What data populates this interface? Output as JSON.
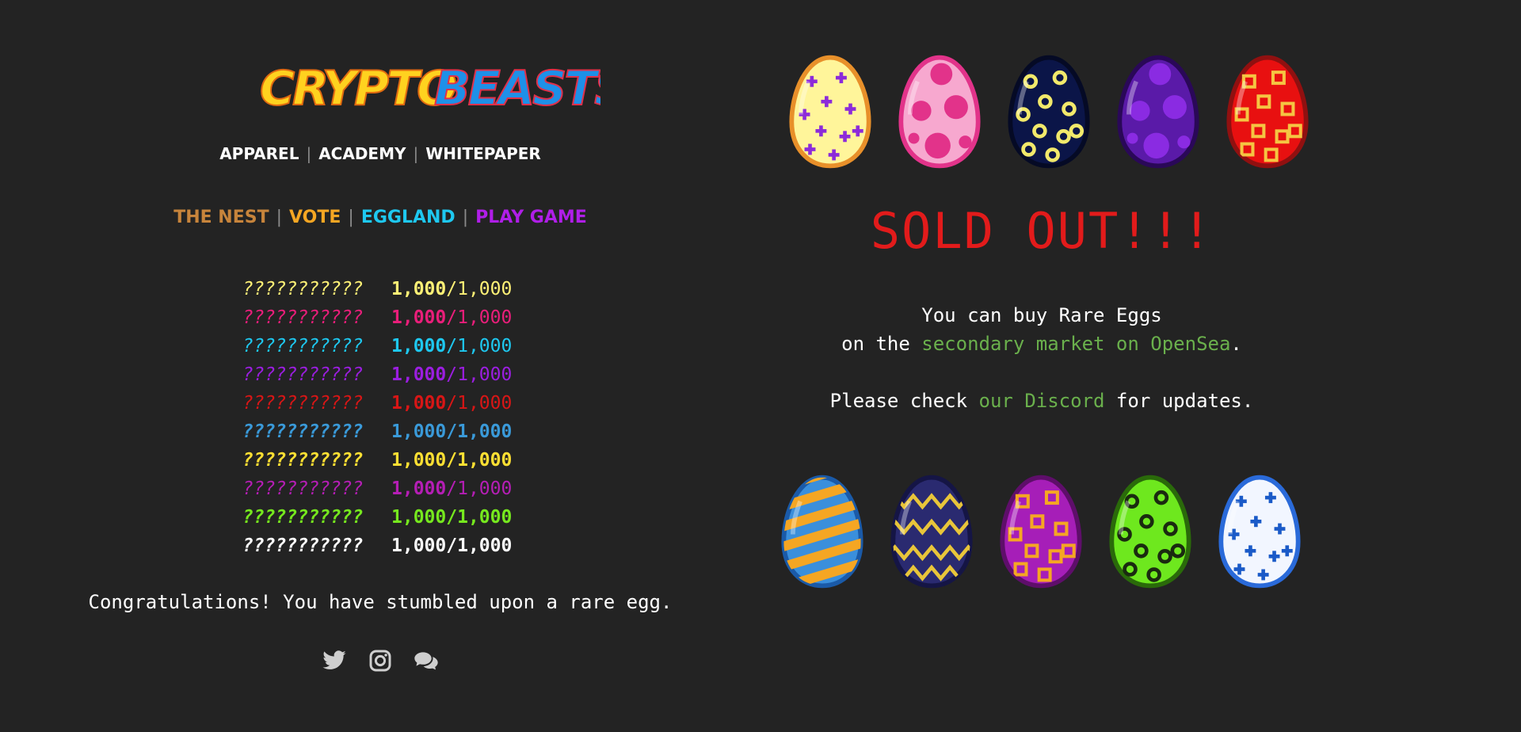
{
  "logo": {
    "text_part1": "CRYPTO",
    "text_part2": "BEASTS",
    "color1": "#ffd21f",
    "color2": "#1e90e8"
  },
  "nav_primary": [
    {
      "label": "APPAREL"
    },
    {
      "label": "ACADEMY"
    },
    {
      "label": "WHITEPAPER"
    }
  ],
  "nav_secondary": [
    {
      "label": "THE NEST",
      "color": "#c7843b"
    },
    {
      "label": "VOTE",
      "color": "#f5a623"
    },
    {
      "label": "EGGLAND",
      "color": "#1ec8f0"
    },
    {
      "label": "PLAY GAME",
      "color": "#b01ee8"
    }
  ],
  "separator": "|",
  "egg_counts": [
    {
      "name": "???????????",
      "minted": "1,000",
      "total": "/1,000",
      "color": "#fff176",
      "bold": false
    },
    {
      "name": "???????????",
      "minted": "1,000",
      "total": "/1,000",
      "color": "#e91e7a",
      "bold": false
    },
    {
      "name": "???????????",
      "minted": "1,000",
      "total": "/1,000",
      "color": "#1ec8f0",
      "bold": false
    },
    {
      "name": "???????????",
      "minted": "1,000",
      "total": "/1,000",
      "color": "#9b1ee0",
      "bold": false
    },
    {
      "name": "???????????",
      "minted": "1,000",
      "total": "/1,000",
      "color": "#d81616",
      "bold": false
    },
    {
      "name": "???????????",
      "minted": "1,000",
      "total": "/1,000",
      "color": "#3a9ad9",
      "bold": true
    },
    {
      "name": "???????????",
      "minted": "1,000",
      "total": "/1,000",
      "color": "#ffe033",
      "bold": true
    },
    {
      "name": "???????????",
      "minted": "1,000",
      "total": "/1,000",
      "color": "#b51eb5",
      "bold": false
    },
    {
      "name": "???????????",
      "minted": "1,000",
      "total": "/1,000",
      "color": "#76e81e",
      "bold": true
    },
    {
      "name": "???????????",
      "minted": "1,000",
      "total": "/1,000",
      "color": "#ffffff",
      "bold": true
    }
  ],
  "congrats": "Congratulations! You have stumbled upon a rare egg.",
  "socials": [
    {
      "icon": "twitter-icon"
    },
    {
      "icon": "instagram-icon"
    },
    {
      "icon": "discord-chat-icon"
    }
  ],
  "sold_out": "SOLD OUT!!!",
  "message": {
    "line1": "You can buy Rare Eggs",
    "line2_prefix": "on the ",
    "line2_link": "secondary market on OpenSea",
    "line2_suffix": ".",
    "line3_prefix": "Please check ",
    "line3_link": "our Discord",
    "line3_suffix": " for updates."
  },
  "eggs_top": [
    {
      "name": "yellow-cross-egg",
      "base": "#fff59a",
      "outline": "#e8902a",
      "spot": "#8c2bd9",
      "pattern": "cross"
    },
    {
      "name": "pink-spotted-egg",
      "base": "#f7a8cf",
      "outline": "#e2338a",
      "spot": "#e2338a",
      "pattern": "dots"
    },
    {
      "name": "navy-ring-egg",
      "base": "#0b1548",
      "outline": "#050a25",
      "spot": "#f2e96b",
      "pattern": "rings"
    },
    {
      "name": "purple-spotted-egg",
      "base": "#5a1aa8",
      "outline": "#2a0858",
      "spot": "#8a2be2",
      "pattern": "dots"
    },
    {
      "name": "red-gold-egg",
      "base": "#e81010",
      "outline": "#901010",
      "spot": "#f5c542",
      "pattern": "squares"
    }
  ],
  "eggs_bottom": [
    {
      "name": "blue-striped-egg",
      "base": "#3a8fdc",
      "outline": "#1a5aa8",
      "spot": "#f5a623",
      "pattern": "stripes"
    },
    {
      "name": "navy-zigzag-egg",
      "base": "#2a2a70",
      "outline": "#151545",
      "spot": "#e8c53a",
      "pattern": "zigzag"
    },
    {
      "name": "magenta-square-egg",
      "base": "#a61eb8",
      "outline": "#5e0e6a",
      "spot": "#f5a623",
      "pattern": "squares"
    },
    {
      "name": "green-flower-egg",
      "base": "#6ee81e",
      "outline": "#2a6a0a",
      "spot": "#1a2a10",
      "pattern": "rings"
    },
    {
      "name": "white-blue-egg",
      "base": "#f2f6ff",
      "outline": "#2a6ad9",
      "spot": "#1a5ac8",
      "pattern": "cross"
    }
  ]
}
